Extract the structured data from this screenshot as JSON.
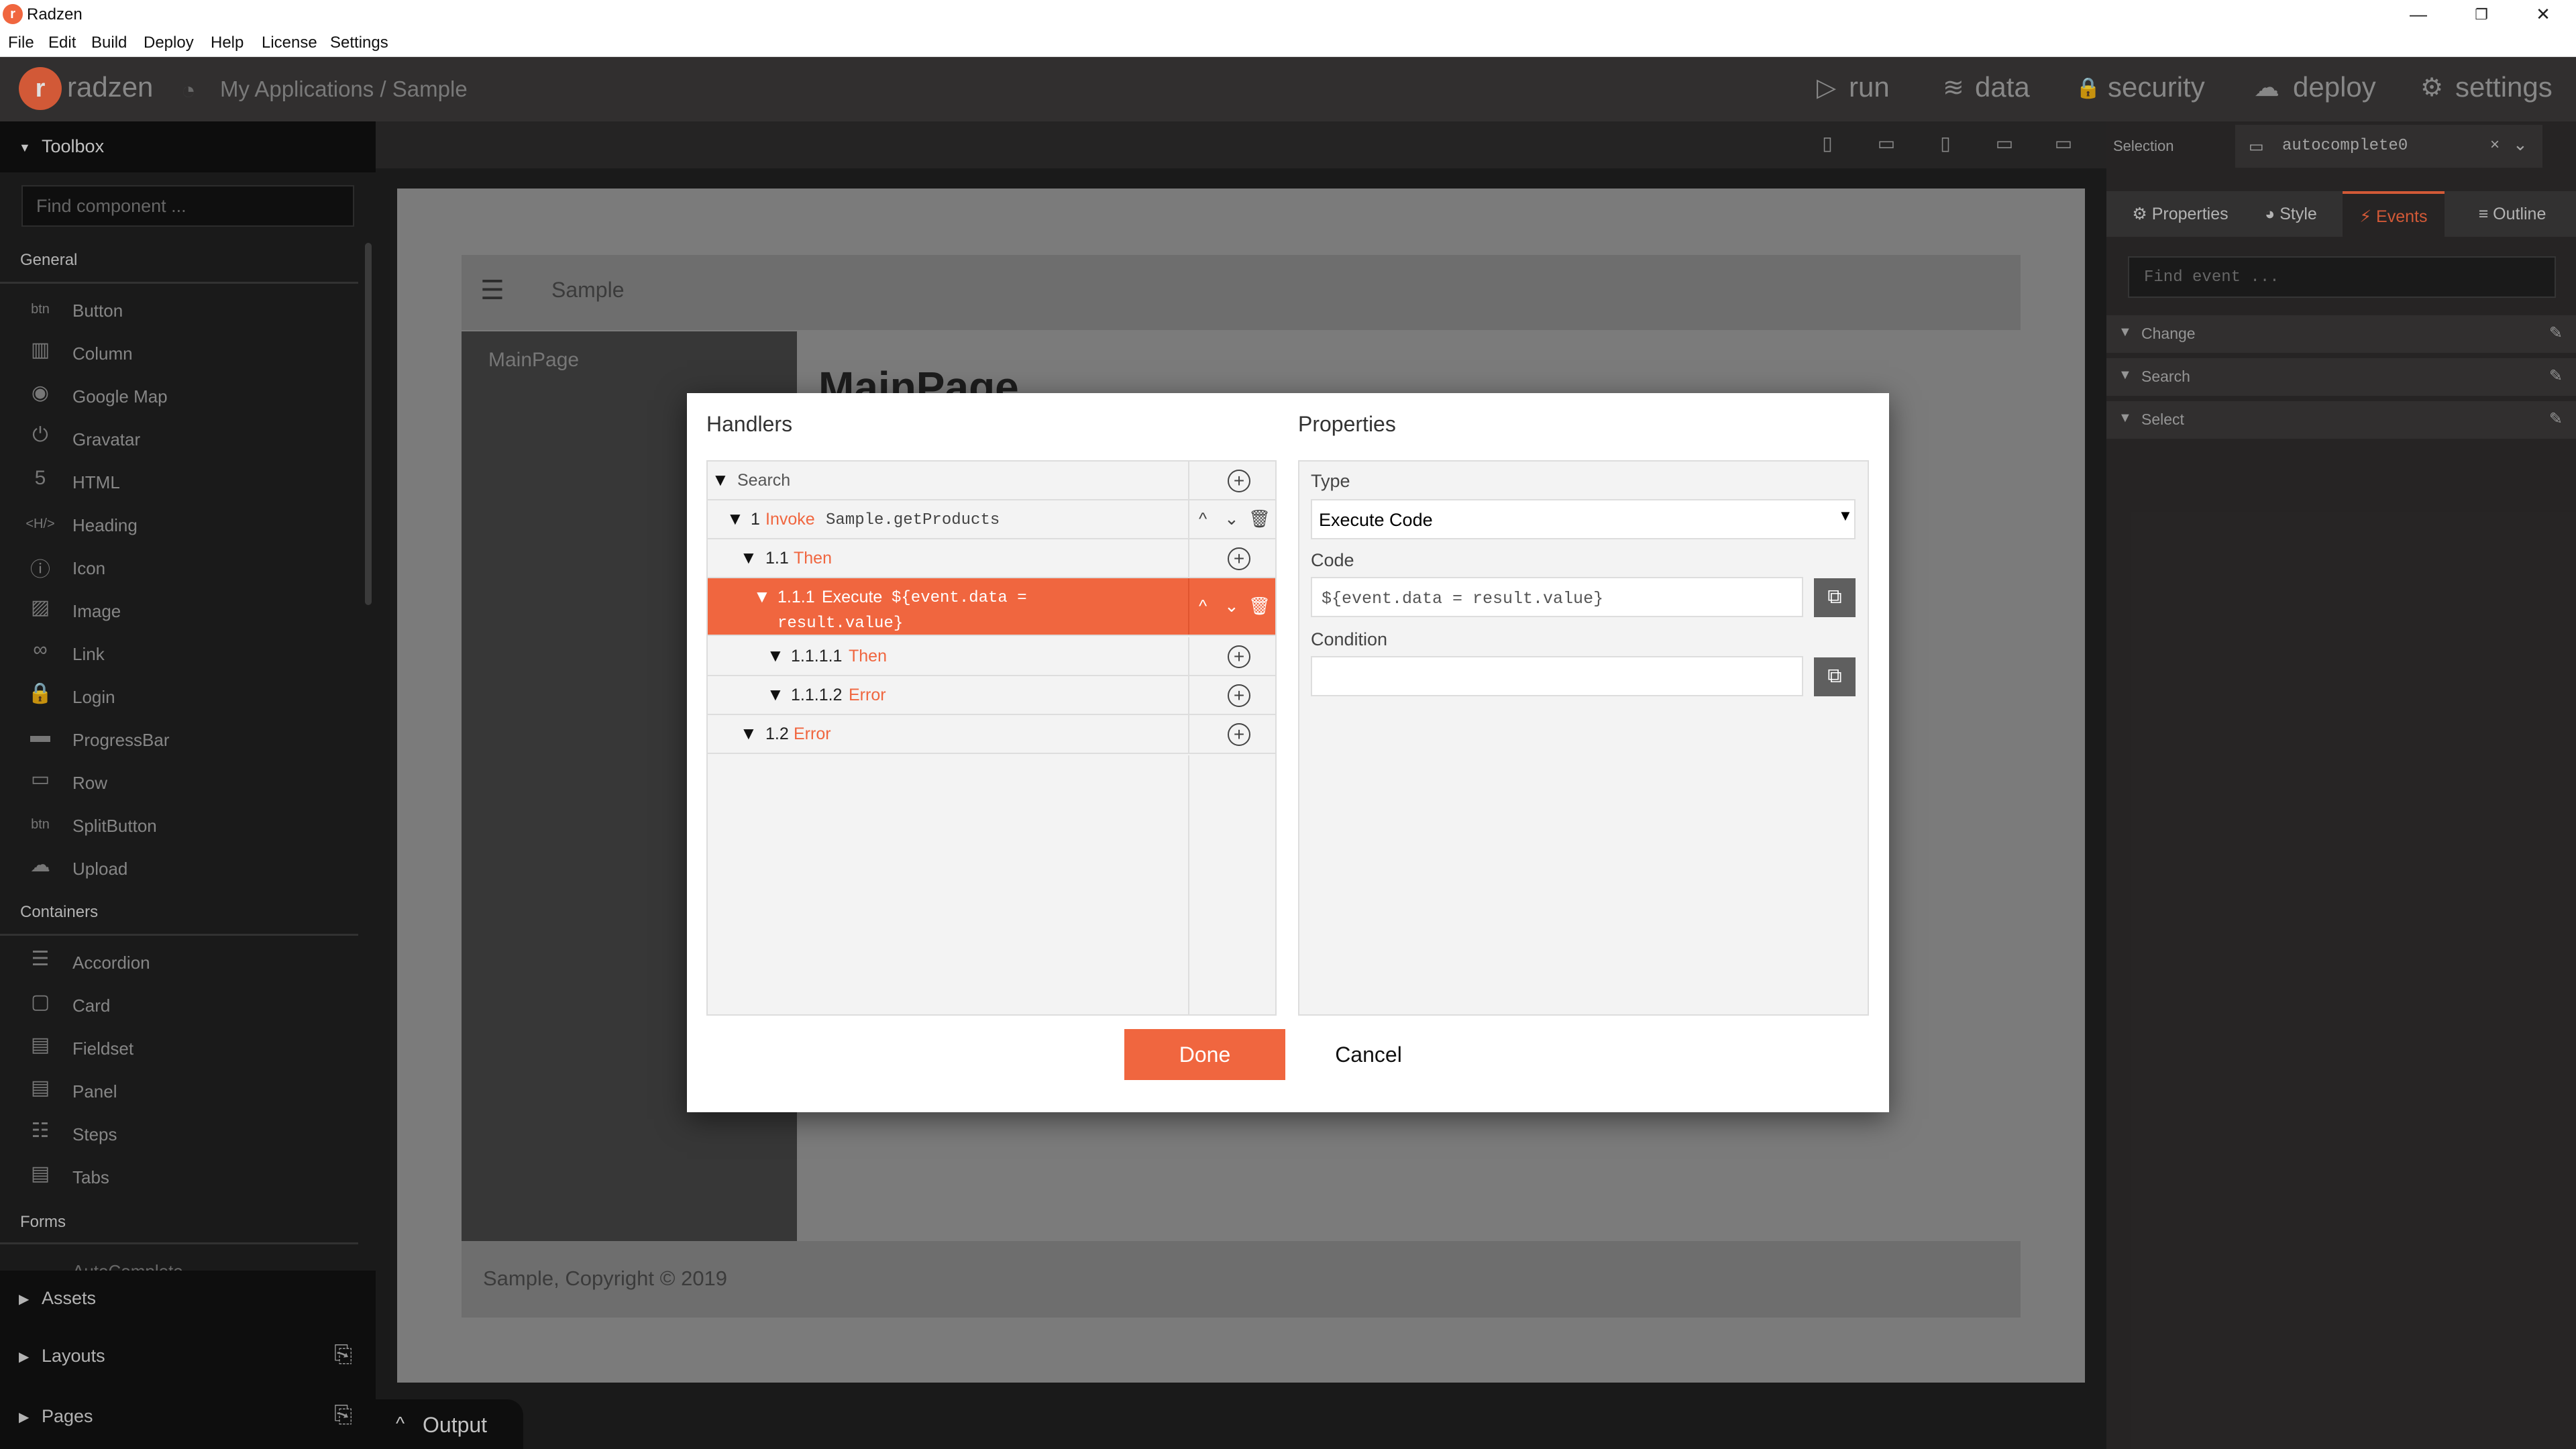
{
  "window": {
    "title": "Radzen",
    "logo_letter": "r",
    "minimize": "—",
    "restore": "❐",
    "close": "✕"
  },
  "menubar": [
    "File",
    "Edit",
    "Build",
    "Deploy",
    "Help",
    "License",
    "Settings"
  ],
  "header": {
    "logo": "radzen",
    "breadcrumb": "My Applications / Sample",
    "nav": [
      {
        "label": "run",
        "icon": "play-icon",
        "glyph": "▷"
      },
      {
        "label": "data",
        "icon": "layers-icon",
        "glyph": "≋"
      },
      {
        "label": "security",
        "icon": "lock-icon",
        "glyph": "🔒"
      },
      {
        "label": "deploy",
        "icon": "cloud-upload-icon",
        "glyph": "☁"
      },
      {
        "label": "settings",
        "icon": "gear-icon",
        "glyph": "⚙"
      }
    ]
  },
  "toolbox": {
    "title": "Toolbox",
    "search_placeholder": "Find component ...",
    "general_label": "General",
    "general": [
      {
        "label": "Button",
        "icon": "button-icon",
        "glyph": "btn"
      },
      {
        "label": "Column",
        "icon": "column-icon",
        "glyph": "▥"
      },
      {
        "label": "Google Map",
        "icon": "compass-icon",
        "glyph": "◉"
      },
      {
        "label": "Gravatar",
        "icon": "gravatar-icon",
        "glyph": "⏻"
      },
      {
        "label": "HTML",
        "icon": "html5-icon",
        "glyph": "5"
      },
      {
        "label": "Heading",
        "icon": "heading-icon",
        "glyph": "<H/>"
      },
      {
        "label": "Icon",
        "icon": "info-icon",
        "glyph": "ⓘ"
      },
      {
        "label": "Image",
        "icon": "image-icon",
        "glyph": "▨"
      },
      {
        "label": "Link",
        "icon": "link-icon",
        "glyph": "∞"
      },
      {
        "label": "Login",
        "icon": "lock-icon",
        "glyph": "🔒"
      },
      {
        "label": "ProgressBar",
        "icon": "progressbar-icon",
        "glyph": "▬"
      },
      {
        "label": "Row",
        "icon": "row-icon",
        "glyph": "▭"
      },
      {
        "label": "SplitButton",
        "icon": "splitbutton-icon",
        "glyph": "btn"
      },
      {
        "label": "Upload",
        "icon": "cloud-upload-icon",
        "glyph": "☁"
      }
    ],
    "containers_label": "Containers",
    "containers": [
      {
        "label": "Accordion",
        "icon": "accordion-icon",
        "glyph": "☰"
      },
      {
        "label": "Card",
        "icon": "card-icon",
        "glyph": "▢"
      },
      {
        "label": "Fieldset",
        "icon": "fieldset-icon",
        "glyph": "▤"
      },
      {
        "label": "Panel",
        "icon": "panel-icon",
        "glyph": "▤"
      },
      {
        "label": "Steps",
        "icon": "steps-icon",
        "glyph": "☷"
      },
      {
        "label": "Tabs",
        "icon": "tabs-icon",
        "glyph": "▤"
      }
    ],
    "forms_label": "Forms",
    "forms_partial": "AutoComplete"
  },
  "bottom_panels": [
    {
      "label": "Assets",
      "action_icon": ""
    },
    {
      "label": "Layouts",
      "action_icon": "add-page-icon"
    },
    {
      "label": "Pages",
      "action_icon": "add-page-icon"
    }
  ],
  "device_bar": [
    {
      "icon": "phone-portrait-icon",
      "glyph": "▯"
    },
    {
      "icon": "phone-landscape-icon",
      "glyph": "▭"
    },
    {
      "icon": "tablet-portrait-icon",
      "glyph": "▯"
    },
    {
      "icon": "tablet-landscape-icon",
      "glyph": "▭"
    },
    {
      "icon": "desktop-icon",
      "glyph": "▭"
    }
  ],
  "page_preview": {
    "menu_glyph": "☰",
    "title": "Sample",
    "sidebar_item": "MainPage",
    "main_heading": "MainPage",
    "footer": "Sample, Copyright © 2019"
  },
  "output_tab": {
    "label": "Output",
    "chev": "^"
  },
  "right_panel": {
    "selection_label": "Selection",
    "selection_value": "autocomplete0",
    "tabs": [
      {
        "label": "Properties",
        "icon": "gear-icon",
        "glyph": "⚙"
      },
      {
        "label": "Style",
        "icon": "palette-icon",
        "glyph": "◕"
      },
      {
        "label": "Events",
        "icon": "bolt-icon",
        "glyph": "⚡"
      },
      {
        "label": "Outline",
        "icon": "list-icon",
        "glyph": "≡"
      }
    ],
    "active_tab": "Events",
    "find_placeholder": "Find event ...",
    "events": [
      "Change",
      "Search",
      "Select"
    ]
  },
  "dialog": {
    "handlers_title": "Handlers",
    "properties_title": "Properties",
    "handlers": [
      {
        "level": 0,
        "num": "",
        "keyword": "",
        "kw_label": "Search",
        "code": "",
        "controls": false,
        "active": false
      },
      {
        "level": 1,
        "num": "1",
        "keyword": "Invoke",
        "code": "Sample.getProducts",
        "controls": true,
        "active": false
      },
      {
        "level": 2,
        "num": "1.1",
        "keyword": "Then",
        "code": "",
        "controls": false,
        "active": false
      },
      {
        "level": 3,
        "num": "1.1.1",
        "keyword": "Execute",
        "code": "${event.data =",
        "code2": "result.value}",
        "controls": true,
        "active": true
      },
      {
        "level": 4,
        "num": "1.1.1.1",
        "keyword": "Then",
        "code": "",
        "controls": false,
        "active": false
      },
      {
        "level": 4,
        "num": "1.1.1.2",
        "keyword": "Error",
        "code": "",
        "controls": false,
        "active": false
      },
      {
        "level": 2,
        "num": "1.2",
        "keyword": "Error",
        "code": "",
        "controls": false,
        "active": false
      }
    ],
    "type_label": "Type",
    "type_value": "Execute Code",
    "code_label": "Code",
    "code_value": "${event.data = result.value}",
    "condition_label": "Condition",
    "condition_value": "",
    "done_label": "Done",
    "cancel_label": "Cancel"
  },
  "colors": {
    "accent": "#f0663f",
    "header_bg": "#383636",
    "toolbox_bg": "#1e1e1e"
  }
}
